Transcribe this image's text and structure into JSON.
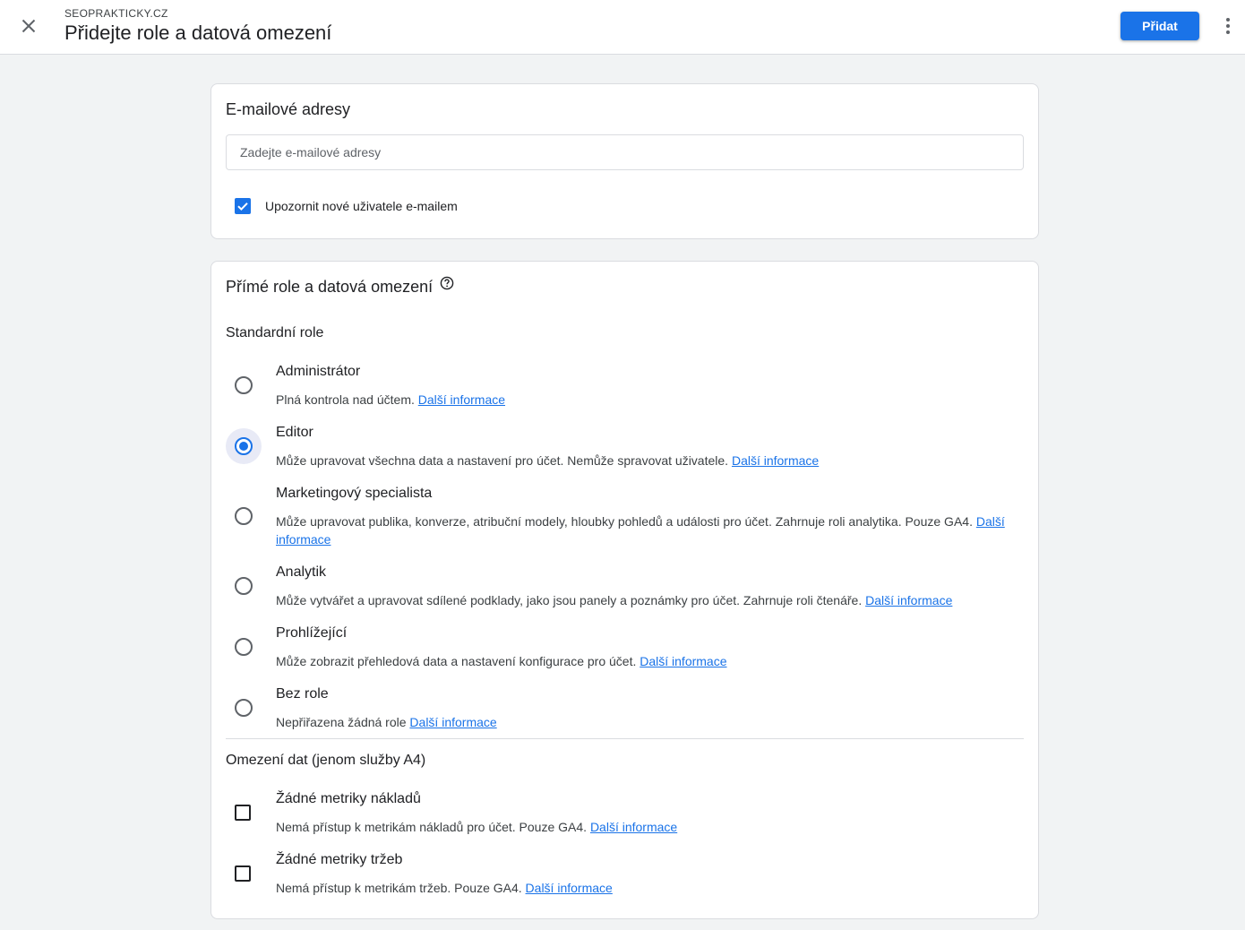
{
  "header": {
    "account": "SEOPRAKTICKY.CZ",
    "title": "Přidejte role a datová omezení",
    "add_label": "Přidat"
  },
  "email_card": {
    "title": "E-mailové adresy",
    "placeholder": "Zadejte e-mailové adresy",
    "value": "",
    "notify_label": "Upozornit nové uživatele e-mailem",
    "notify_checked": true
  },
  "roles_card": {
    "title": "Přímé role a datová omezení",
    "standard_label": "Standardní role",
    "more_info": "Další informace",
    "roles": [
      {
        "title": "Administrátor",
        "desc": "Plná kontrola nad účtem.",
        "selected": false
      },
      {
        "title": "Editor",
        "desc": "Může upravovat všechna data a nastavení pro účet. Nemůže spravovat uživatele.",
        "selected": true
      },
      {
        "title": "Marketingový specialista",
        "desc": "Může upravovat publika, konverze, atribuční modely, hloubky pohledů a události pro účet. Zahrnuje roli analytika. Pouze GA4.",
        "selected": false
      },
      {
        "title": "Analytik",
        "desc": "Může vytvářet a upravovat sdílené podklady, jako jsou panely a poznámky pro účet. Zahrnuje roli čtenáře.",
        "selected": false
      },
      {
        "title": "Prohlížející",
        "desc": "Může zobrazit přehledová data a nastavení konfigurace pro účet.",
        "selected": false
      },
      {
        "title": "Bez role",
        "desc": "Nepřiřazena žádná role",
        "selected": false
      }
    ],
    "data_label": "Omezení dat (jenom služby A4)",
    "restrictions": [
      {
        "title": "Žádné metriky nákladů",
        "desc": "Nemá přístup k metrikám nákladů pro účet. Pouze GA4.",
        "checked": false
      },
      {
        "title": "Žádné metriky tržeb",
        "desc": "Nemá přístup k metrikám tržeb. Pouze GA4.",
        "checked": false
      }
    ]
  },
  "colors": {
    "accent": "#1a73e8",
    "background": "#f1f3f4"
  }
}
